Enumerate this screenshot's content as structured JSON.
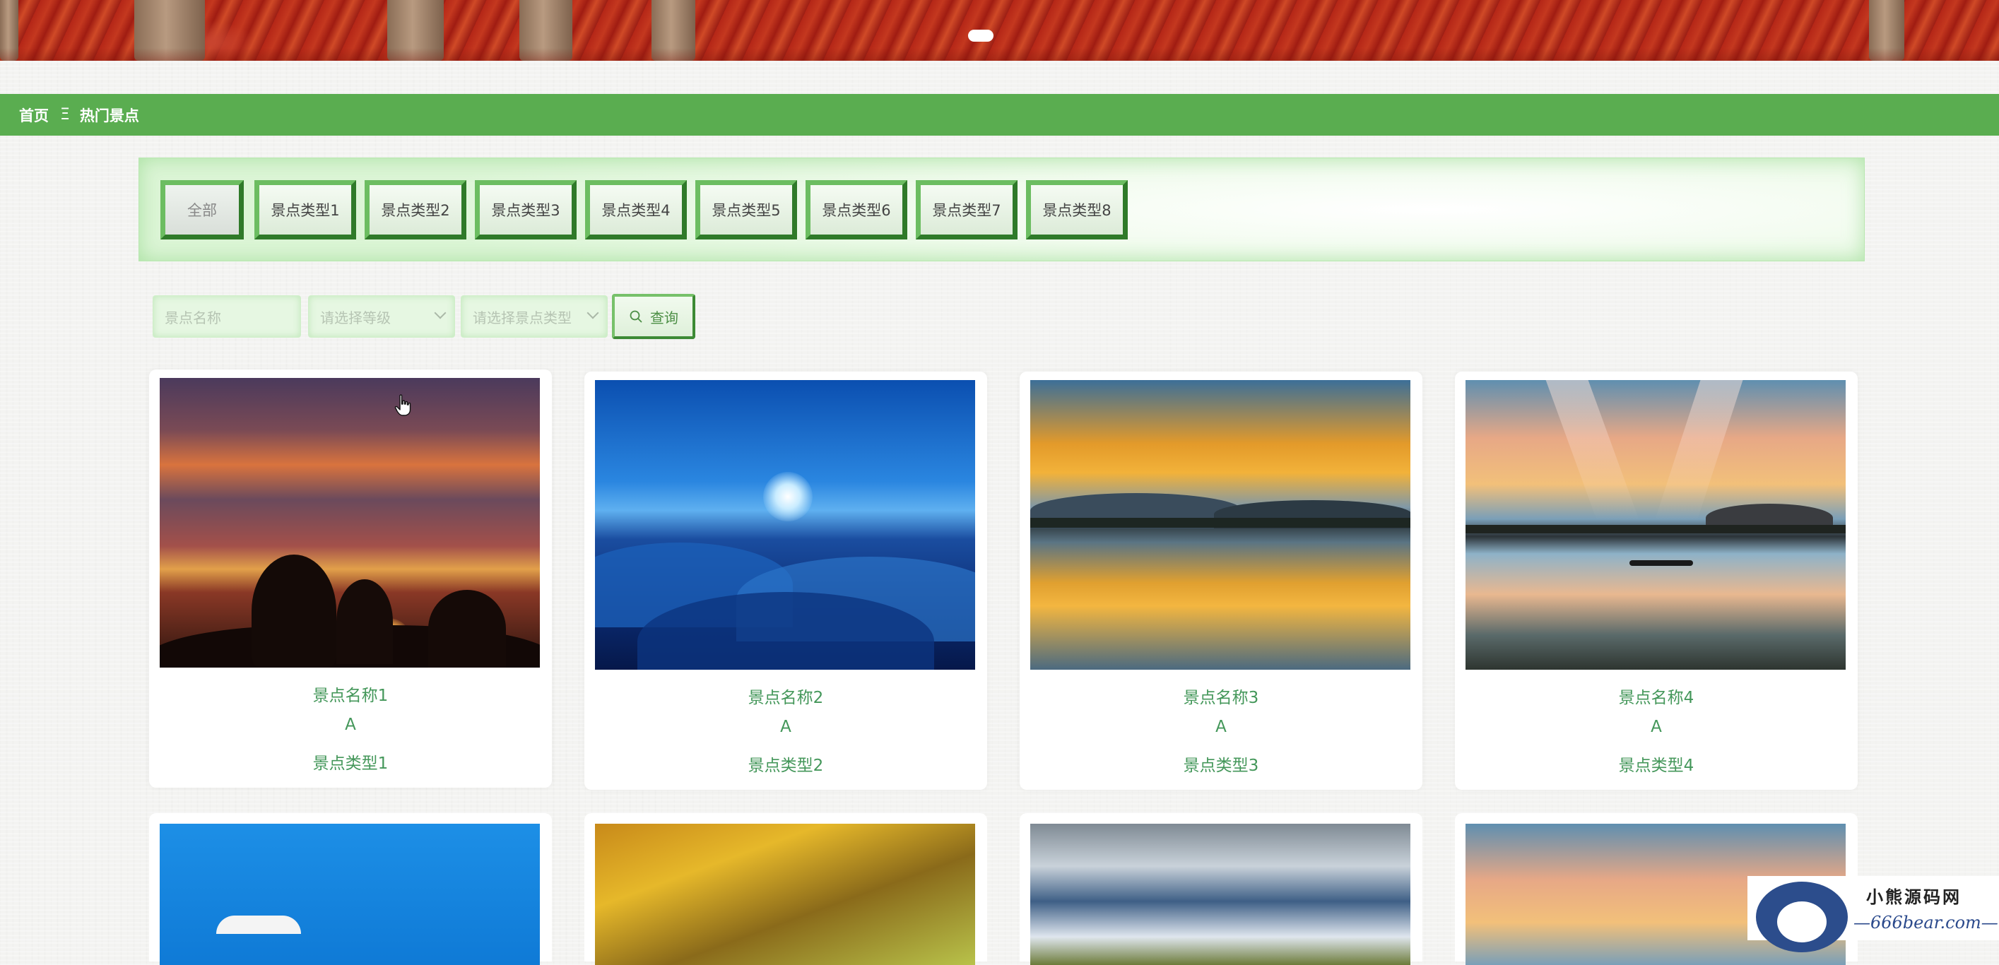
{
  "breadcrumb": {
    "home": "首页",
    "separator": "Ξ",
    "current": "热门景点"
  },
  "categories": [
    "全部",
    "景点类型1",
    "景点类型2",
    "景点类型3",
    "景点类型4",
    "景点类型5",
    "景点类型6",
    "景点类型7",
    "景点类型8"
  ],
  "search": {
    "name_placeholder": "景点名称",
    "level_placeholder": "请选择等级",
    "type_placeholder": "请选择景点类型",
    "button_label": "查询"
  },
  "cards": [
    {
      "name": "景点名称1",
      "level": "A",
      "type": "景点类型1"
    },
    {
      "name": "景点名称2",
      "level": "A",
      "type": "景点类型2"
    },
    {
      "name": "景点名称3",
      "level": "A",
      "type": "景点类型3"
    },
    {
      "name": "景点名称4",
      "level": "A",
      "type": "景点类型4"
    }
  ],
  "watermark": {
    "title": "小熊源码网",
    "url": "—666bear.com—"
  },
  "colors": {
    "accent_green": "#5aad50",
    "card_text": "#44975a"
  },
  "icons": [
    "search-icon",
    "chevron-down-icon",
    "hand-cursor-icon"
  ]
}
